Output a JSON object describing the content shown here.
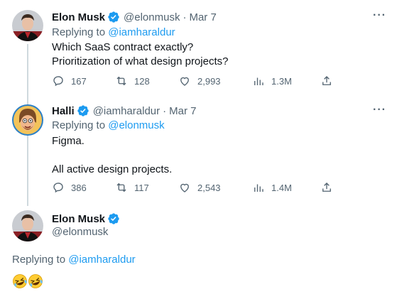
{
  "tweets": [
    {
      "name": "Elon Musk",
      "handle": "@elonmusk",
      "sep": "·",
      "date": "Mar 7",
      "replying_prefix": "Replying to",
      "replying_to": "@iamharaldur",
      "lines": [
        "Which SaaS contract exactly?",
        "Prioritization of what design projects?"
      ],
      "stats": {
        "replies": "167",
        "retweets": "128",
        "likes": "2,993",
        "views": "1.3M"
      }
    },
    {
      "name": "Halli",
      "handle": "@iamharaldur",
      "sep": "·",
      "date": "Mar 7",
      "replying_prefix": "Replying to",
      "replying_to": "@elonmusk",
      "lines": [
        "Figma.",
        "All active design projects."
      ],
      "stats": {
        "replies": "386",
        "retweets": "117",
        "likes": "2,543",
        "views": "1.4M"
      }
    },
    {
      "name": "Elon Musk",
      "handle": "@elonmusk",
      "replying_prefix": "Replying to",
      "replying_to": "@iamharaldur",
      "text": "🤣🤣"
    }
  ],
  "ui": {
    "more_label": "···"
  },
  "colors": {
    "accent": "#1d9bf0",
    "muted": "#536471",
    "thread_line": "#cfd9de"
  }
}
